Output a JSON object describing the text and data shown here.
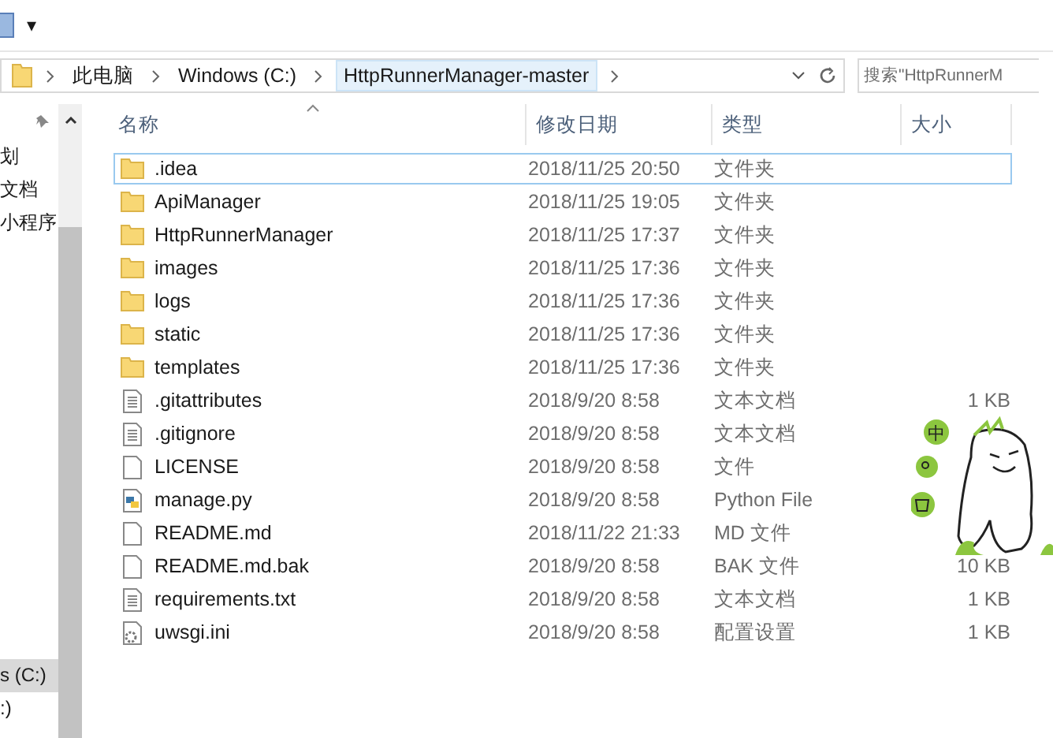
{
  "toolbar": {
    "dropdown": "▾"
  },
  "address_bar": {
    "crumbs": [
      {
        "label": "此电脑",
        "current": false
      },
      {
        "label": "Windows (C:)",
        "current": false
      },
      {
        "label": "HttpRunnerManager-master",
        "current": true
      }
    ]
  },
  "search": {
    "placeholder": "搜索\"HttpRunnerM"
  },
  "sidebar": {
    "items": [
      {
        "label": "划",
        "selected": false
      },
      {
        "label": "文档",
        "selected": false
      },
      {
        "label": "小程序",
        "selected": false
      },
      {
        "label": "s (C:)",
        "selected": true
      },
      {
        "label": ":)",
        "selected": false
      }
    ]
  },
  "table": {
    "columns": [
      "名称",
      "修改日期",
      "类型",
      "大小"
    ],
    "rows": [
      {
        "kind": "folder",
        "name": ".idea",
        "date": "2018/11/25 20:50",
        "type": "文件夹",
        "focused": true
      },
      {
        "kind": "folder",
        "name": "ApiManager",
        "date": "2018/11/25 19:05",
        "type": "文件夹",
        "focused": false
      },
      {
        "kind": "folder",
        "name": "HttpRunnerManager",
        "date": "2018/11/25 17:37",
        "type": "文件夹",
        "focused": false
      },
      {
        "kind": "folder",
        "name": "images",
        "date": "2018/11/25 17:36",
        "type": "文件夹",
        "focused": false
      },
      {
        "kind": "folder",
        "name": "logs",
        "date": "2018/11/25 17:36",
        "type": "文件夹",
        "focused": false
      },
      {
        "kind": "folder",
        "name": "static",
        "date": "2018/11/25 17:36",
        "type": "文件夹",
        "focused": false
      },
      {
        "kind": "folder",
        "name": "templates",
        "date": "2018/11/25 17:36",
        "type": "文件夹",
        "focused": false
      },
      {
        "kind": "text",
        "name": ".gitattributes",
        "date": "2018/9/20 8:58",
        "type": "文本文档",
        "size": "1 KB",
        "focused": false
      },
      {
        "kind": "text",
        "name": ".gitignore",
        "date": "2018/9/20 8:58",
        "type": "文本文档",
        "focused": false
      },
      {
        "kind": "file",
        "name": "LICENSE",
        "date": "2018/9/20 8:58",
        "type": "文件",
        "focused": false
      },
      {
        "kind": "python",
        "name": "manage.py",
        "date": "2018/9/20 8:58",
        "type": "Python File",
        "focused": false
      },
      {
        "kind": "file",
        "name": "README.md",
        "date": "2018/11/22 21:33",
        "type": "MD 文件",
        "focused": false
      },
      {
        "kind": "file",
        "name": "README.md.bak",
        "date": "2018/9/20 8:58",
        "type": "BAK 文件",
        "size": "10 KB",
        "focused": false
      },
      {
        "kind": "text",
        "name": "requirements.txt",
        "date": "2018/9/20 8:58",
        "type": "文本文档",
        "size": "1 KB",
        "focused": false
      },
      {
        "kind": "config",
        "name": "uwsgi.ini",
        "date": "2018/9/20 8:58",
        "type": "配置设置",
        "size": "1 KB",
        "focused": false
      }
    ]
  },
  "ime_widget": {
    "badge": "中"
  }
}
